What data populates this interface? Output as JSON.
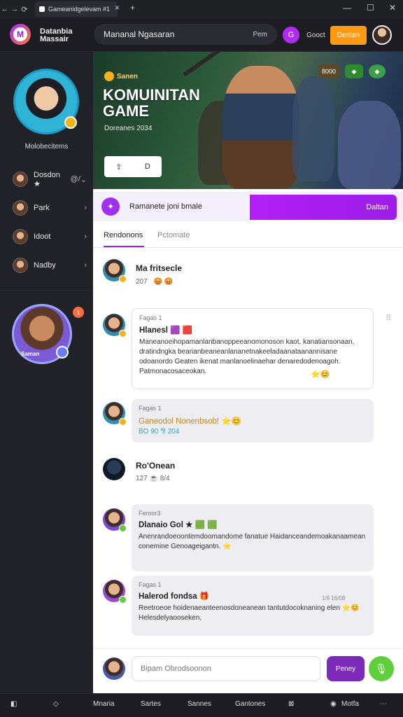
{
  "browser": {
    "tab_title": "Gameanidgelevam #1",
    "back": "←",
    "forward": "→",
    "reload": "⟳"
  },
  "header": {
    "brand_line1": "Datanbia",
    "brand_line2": "Massair",
    "search_value": "Mananal Ngasaran",
    "search_button": "Pem",
    "round_button": "G",
    "link": "Gooct",
    "orange_button": "Dentan"
  },
  "sidebar": {
    "hero_name": "Molobecitems",
    "items": [
      {
        "label": "Dosdon ★",
        "extra": "@/",
        "chevron": "⌄"
      },
      {
        "label": "Park",
        "chevron": "›"
      },
      {
        "label": "Idoot",
        "chevron": "›"
      },
      {
        "label": "Nadby",
        "chevron": "›"
      }
    ],
    "notification_count": "1",
    "featured_label": "Saman"
  },
  "banner": {
    "tag": "Sanen",
    "title": "KOMUINITAN GAME",
    "subtitle": "Doreanes 2034",
    "action_icon_1": "⇪",
    "action_icon_2": "D",
    "badge_1": "8000",
    "badge_2": "◆",
    "badge_3": "◆",
    "colors": {
      "badge_1": "#5a4a2a",
      "badge_2": "#2e8a2e",
      "badge_3": "#3ca04a"
    }
  },
  "promo": {
    "text": "Ramanete joni bmale",
    "button": "Daltan"
  },
  "tabs": {
    "active": "Rendonons",
    "inactive": "Pctomate"
  },
  "feed": [
    {
      "title": "Ma fritsecle",
      "meta": "207",
      "reactions": "😡 😡"
    },
    {
      "small": "Fagas 1",
      "title": "Hlanesl 🟪 🟥",
      "body": "Maneanoeihopamanlanbanoppeeanomonoson kaot, kanatiansonaan, dratindngka bearianbeaneanlananetnakeeladaanataanannisane odoanordo Geaten ikenat manlanoelinaehar denaredodenoagoh. Patmonacosaceokan.",
      "emoji": "⭐😊",
      "dots": "⠿"
    },
    {
      "small": "Fagas 1",
      "title": "Ganeodol Nonenbsob! ⭐😊",
      "meta": "BO 90 ⅋ 204"
    },
    {
      "title": "Ro'Onean",
      "meta": "127 ☕ 8/4"
    },
    {
      "small": "Feroor3",
      "title": "Dlanaio Gol ★ 🟩 🟩",
      "body": "Anenrandoeoontemdoomandome fanatue Haidanceandemoakanaamean conemine Genoageigantn. ⭐"
    },
    {
      "small": "Fagas 1",
      "title": "Halerod fondsa 🎁",
      "timestamp": "1/9 16/08",
      "body": "Reetroeoe hoidenaeanteenosdoneanean tantutdocoknaning elen ⭐😊 Helesdelyaooseken."
    }
  ],
  "composer": {
    "placeholder": "Bipam Obrodsoonon",
    "send": "Peney",
    "mic": "🎙"
  },
  "bottombar": {
    "items": [
      "Mnaria",
      "Sartes",
      "Sannes",
      "Gantones"
    ],
    "right": "Motfa",
    "more": "⋯"
  }
}
